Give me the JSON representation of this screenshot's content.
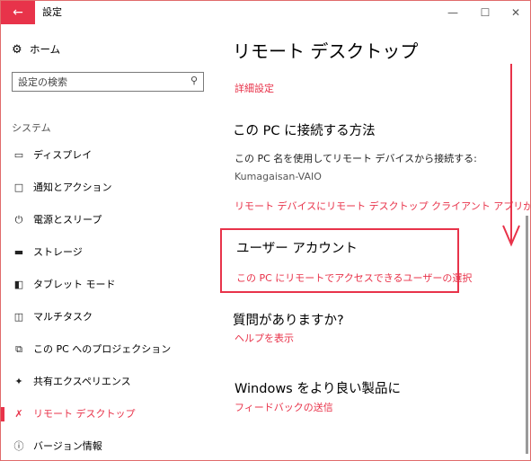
{
  "window": {
    "title": "設定"
  },
  "sidebar": {
    "home_label": "ホーム",
    "search_placeholder": "設定の検索",
    "category": "システム",
    "items": [
      {
        "label": "ディスプレイ",
        "icon": "display-icon"
      },
      {
        "label": "通知とアクション",
        "icon": "notification-icon"
      },
      {
        "label": "電源とスリープ",
        "icon": "power-icon"
      },
      {
        "label": "ストレージ",
        "icon": "storage-icon"
      },
      {
        "label": "タブレット モード",
        "icon": "tablet-icon"
      },
      {
        "label": "マルチタスク",
        "icon": "multitask-icon"
      },
      {
        "label": "この PC へのプロジェクション",
        "icon": "projection-icon"
      },
      {
        "label": "共有エクスペリエンス",
        "icon": "shared-icon"
      },
      {
        "label": "リモート デスクトップ",
        "icon": "remote-desktop-icon",
        "active": true
      },
      {
        "label": "バージョン情報",
        "icon": "info-icon"
      }
    ]
  },
  "main": {
    "title": "リモート デスクトップ",
    "advanced_link": "詳細設定",
    "connect_heading": "この PC に接続する方法",
    "connect_desc": "この PC 名を使用してリモート デバイスから接続する:",
    "pc_name": "Kumagaisan-VAIO",
    "no_client_link": "リモート デバイスにリモート デスクトップ クライアント アプリがない場合",
    "user_heading": "ユーザー アカウント",
    "user_link": "この PC にリモートでアクセスできるユーザーの選択",
    "help_heading": "質問がありますか?",
    "help_link": "ヘルプを表示",
    "windows_heading": "Windows をより良い製品に",
    "feedback_link": "フィードバックの送信"
  },
  "colors": {
    "accent": "#e8334a",
    "annotation": "#e8334a"
  }
}
